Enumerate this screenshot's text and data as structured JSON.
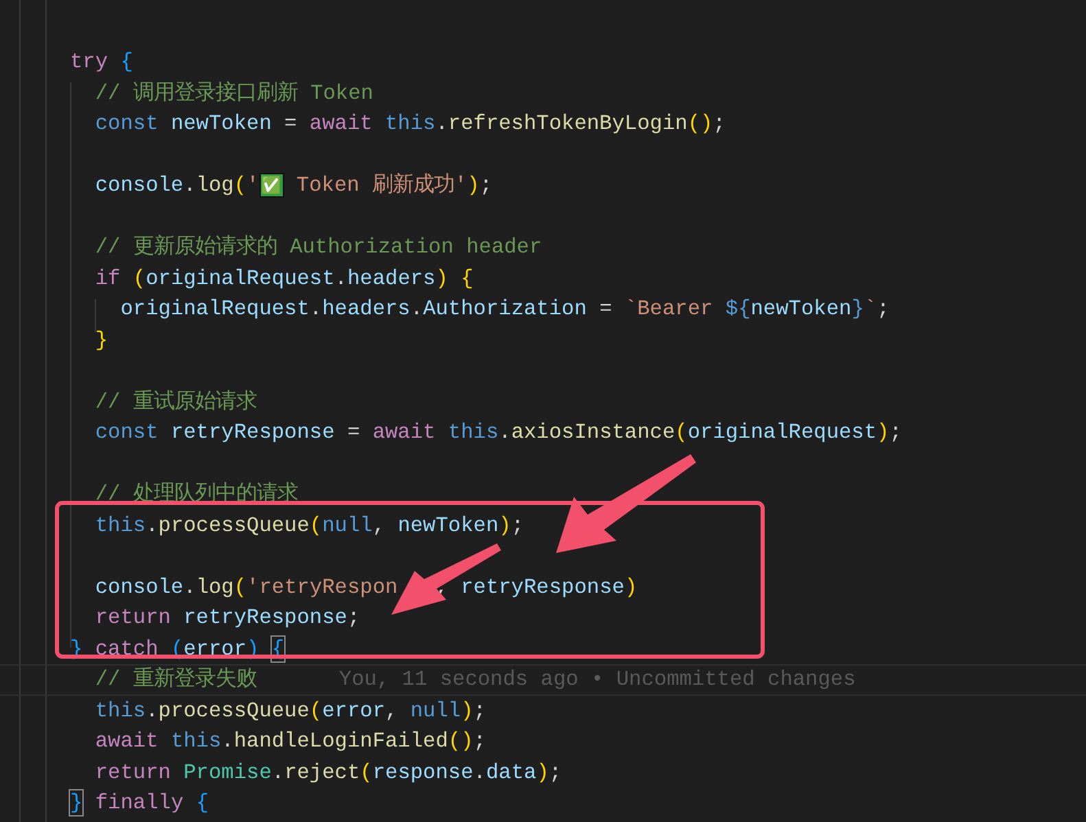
{
  "editor": {
    "lines": [
      {
        "blank_after": false,
        "tokens": [
          {
            "kind": "kw",
            "text": "try "
          },
          {
            "kind": "b3",
            "text": "{"
          }
        ]
      },
      {
        "blank_after": false,
        "tokens": [
          {
            "kind": "cm",
            "text": "  // 调用登录接口刷新 Token"
          }
        ]
      },
      {
        "blank_after": true,
        "tokens": [
          {
            "kind": "st",
            "text": "  const "
          },
          {
            "kind": "var",
            "text": "newToken"
          },
          {
            "kind": "p",
            "text": " = "
          },
          {
            "kind": "kw",
            "text": "await "
          },
          {
            "kind": "st",
            "text": "this"
          },
          {
            "kind": "p",
            "text": "."
          },
          {
            "kind": "fn",
            "text": "refreshTokenByLogin"
          },
          {
            "kind": "b1",
            "text": "()"
          },
          {
            "kind": "p",
            "text": ";"
          }
        ]
      },
      {
        "blank_after": true,
        "tokens": [
          {
            "kind": "var",
            "text": "  console"
          },
          {
            "kind": "p",
            "text": "."
          },
          {
            "kind": "fn",
            "text": "log"
          },
          {
            "kind": "b1",
            "text": "("
          },
          {
            "kind": "str",
            "text": "'"
          },
          {
            "kind": "emoji",
            "text": "✅"
          },
          {
            "kind": "str",
            "text": " Token 刷新成功'"
          },
          {
            "kind": "b1",
            "text": ")"
          },
          {
            "kind": "p",
            "text": ";"
          }
        ]
      },
      {
        "blank_after": false,
        "tokens": [
          {
            "kind": "cm",
            "text": "  // 更新原始请求的 Authorization header"
          }
        ]
      },
      {
        "blank_after": false,
        "tokens": [
          {
            "kind": "kw",
            "text": "  if "
          },
          {
            "kind": "b1",
            "text": "("
          },
          {
            "kind": "var",
            "text": "originalRequest"
          },
          {
            "kind": "p",
            "text": "."
          },
          {
            "kind": "var",
            "text": "headers"
          },
          {
            "kind": "b1",
            "text": ") {"
          }
        ]
      },
      {
        "blank_after": false,
        "tokens": [
          {
            "kind": "var",
            "text": "    originalRequest"
          },
          {
            "kind": "p",
            "text": "."
          },
          {
            "kind": "var",
            "text": "headers"
          },
          {
            "kind": "p",
            "text": "."
          },
          {
            "kind": "var",
            "text": "Authorization"
          },
          {
            "kind": "p",
            "text": " = "
          },
          {
            "kind": "str",
            "text": "`Bearer "
          },
          {
            "kind": "st",
            "text": "${"
          },
          {
            "kind": "var",
            "text": "newToken"
          },
          {
            "kind": "st",
            "text": "}"
          },
          {
            "kind": "str",
            "text": "`"
          },
          {
            "kind": "p",
            "text": ";"
          }
        ]
      },
      {
        "blank_after": true,
        "tokens": [
          {
            "kind": "b1",
            "text": "  }"
          }
        ]
      },
      {
        "blank_after": false,
        "tokens": [
          {
            "kind": "cm",
            "text": "  // 重试原始请求"
          }
        ]
      },
      {
        "blank_after": true,
        "tokens": [
          {
            "kind": "st",
            "text": "  const "
          },
          {
            "kind": "var",
            "text": "retryResponse"
          },
          {
            "kind": "p",
            "text": " = "
          },
          {
            "kind": "kw",
            "text": "await "
          },
          {
            "kind": "st",
            "text": "this"
          },
          {
            "kind": "p",
            "text": "."
          },
          {
            "kind": "fn",
            "text": "axiosInstance"
          },
          {
            "kind": "b1",
            "text": "("
          },
          {
            "kind": "var",
            "text": "originalRequest"
          },
          {
            "kind": "b1",
            "text": ")"
          },
          {
            "kind": "p",
            "text": ";"
          }
        ]
      },
      {
        "blank_after": false,
        "tokens": [
          {
            "kind": "cm",
            "text": "  // 处理队列中的请求"
          }
        ]
      },
      {
        "blank_after": true,
        "tokens": [
          {
            "kind": "st",
            "text": "  this"
          },
          {
            "kind": "p",
            "text": "."
          },
          {
            "kind": "fn",
            "text": "processQueue"
          },
          {
            "kind": "b1",
            "text": "("
          },
          {
            "kind": "st",
            "text": "null"
          },
          {
            "kind": "p",
            "text": ", "
          },
          {
            "kind": "var",
            "text": "newToken"
          },
          {
            "kind": "b1",
            "text": ")"
          },
          {
            "kind": "p",
            "text": ";"
          }
        ]
      },
      {
        "blank_after": false,
        "tokens": [
          {
            "kind": "var",
            "text": "  console"
          },
          {
            "kind": "p",
            "text": "."
          },
          {
            "kind": "fn",
            "text": "log"
          },
          {
            "kind": "b1",
            "text": "("
          },
          {
            "kind": "str",
            "text": "'retryRespon"
          },
          {
            "kind": "pgap",
            "text": ", "
          },
          {
            "kind": "var",
            "text": "retryResponse"
          },
          {
            "kind": "b1",
            "text": ")"
          }
        ]
      },
      {
        "blank_after": false,
        "tokens": [
          {
            "kind": "kw",
            "text": "  return "
          },
          {
            "kind": "var",
            "text": "retryResponse"
          },
          {
            "kind": "p",
            "text": ";"
          }
        ]
      },
      {
        "blank_after": false,
        "tokens": [
          {
            "kind": "b3",
            "text": "} "
          },
          {
            "kind": "kw",
            "text": "catch "
          },
          {
            "kind": "b3",
            "text": "("
          },
          {
            "kind": "var",
            "text": "error"
          },
          {
            "kind": "b3",
            "text": ") "
          },
          {
            "kind": "b3m",
            "text": "{"
          }
        ]
      },
      {
        "blank_after": false,
        "current": true,
        "blame": "You, 11 seconds ago • Uncommitted changes",
        "tokens": [
          {
            "kind": "cm",
            "text": "  // 重新登录失败"
          }
        ]
      },
      {
        "blank_after": false,
        "tokens": [
          {
            "kind": "st",
            "text": "  this"
          },
          {
            "kind": "p",
            "text": "."
          },
          {
            "kind": "fn",
            "text": "processQueue"
          },
          {
            "kind": "b1",
            "text": "("
          },
          {
            "kind": "var",
            "text": "error"
          },
          {
            "kind": "p",
            "text": ", "
          },
          {
            "kind": "st",
            "text": "null"
          },
          {
            "kind": "b1",
            "text": ")"
          },
          {
            "kind": "p",
            "text": ";"
          }
        ]
      },
      {
        "blank_after": false,
        "tokens": [
          {
            "kind": "kw",
            "text": "  await "
          },
          {
            "kind": "st",
            "text": "this"
          },
          {
            "kind": "p",
            "text": "."
          },
          {
            "kind": "fn",
            "text": "handleLoginFailed"
          },
          {
            "kind": "b1",
            "text": "()"
          },
          {
            "kind": "p",
            "text": ";"
          }
        ]
      },
      {
        "blank_after": false,
        "tokens": [
          {
            "kind": "kw",
            "text": "  return "
          },
          {
            "kind": "cls",
            "text": "Promise"
          },
          {
            "kind": "p",
            "text": "."
          },
          {
            "kind": "fn",
            "text": "reject"
          },
          {
            "kind": "b1",
            "text": "("
          },
          {
            "kind": "var",
            "text": "response"
          },
          {
            "kind": "p",
            "text": "."
          },
          {
            "kind": "var",
            "text": "data"
          },
          {
            "kind": "b1",
            "text": ")"
          },
          {
            "kind": "p",
            "text": ";"
          }
        ]
      },
      {
        "blank_after": false,
        "tokens": [
          {
            "kind": "b3m",
            "text": "}"
          },
          {
            "kind": "kw",
            "text": " finally "
          },
          {
            "kind": "b3",
            "text": "{"
          }
        ]
      }
    ]
  }
}
